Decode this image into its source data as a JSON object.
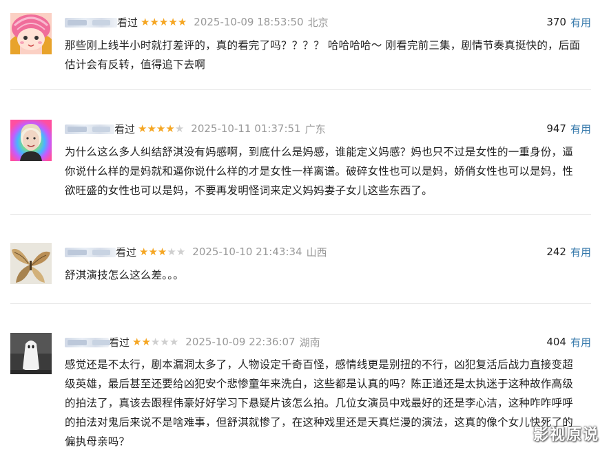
{
  "reviews": [
    {
      "verb": "看过",
      "rating": 5,
      "time": "2025-10-09 18:53:50",
      "location": "北京",
      "useful_count": "370",
      "useful_label": "有用",
      "content": "那些刚上线半小时就打差评的，真的看完了吗？？？？ 哈哈哈哈～ 刚看完前三集，剧情节奏真挺快的，后面估计会有反转，值得追下去啊"
    },
    {
      "verb": "看过",
      "rating": 4,
      "time": "2025-10-11 01:37:51",
      "location": "广东",
      "useful_count": "947",
      "useful_label": "有用",
      "content": "为什么这么多人纠结舒淇没有妈感啊，到底什么是妈感，谁能定义妈感？妈也只不过是女性的一重身份，逼你说什么样的是妈就和逼你说什么样的才是女性一样离谱。破碎女性也可以是妈，娇俏女性也可以是妈，性欲旺盛的女性也可以是妈，不要再发明怪词来定义妈妈妻子女儿这些东西了。"
    },
    {
      "verb": "看过",
      "rating": 3,
      "time": "2025-10-10 21:43:34",
      "location": "山西",
      "useful_count": "242",
      "useful_label": "有用",
      "content": "舒淇演技怎么这么差。。。"
    },
    {
      "verb": "看过",
      "rating": 2,
      "time": "2025-10-09 22:36:07",
      "location": "湖南",
      "useful_count": "404",
      "useful_label": "有用",
      "content": "感觉还是不太行，剧本漏洞太多了，人物设定千奇百怪，感情线更是别扭的不行，凶犯复活后战力直接变超级英雄，最后甚至还要给凶犯安个悲惨童年来洗白，这些都是认真的吗？陈正道还是太执迷于这种故作高级的拍法了，真该去跟程伟豪好好学习下悬疑片该怎么拍。几位女演员中戏最好的还是李心洁，这种咋咋呼呼的拍法对鬼后来说不是啥难事，但舒淇就惨了，在这种戏里还是天真烂漫的演法，这真的像个女儿快死了的偏执母亲吗？"
    }
  ],
  "watermark": "影视原说",
  "colors": {
    "star_on": "#f5a623",
    "star_off": "#cfcfcf",
    "useful_link": "#3377aa",
    "meta": "#999999"
  }
}
